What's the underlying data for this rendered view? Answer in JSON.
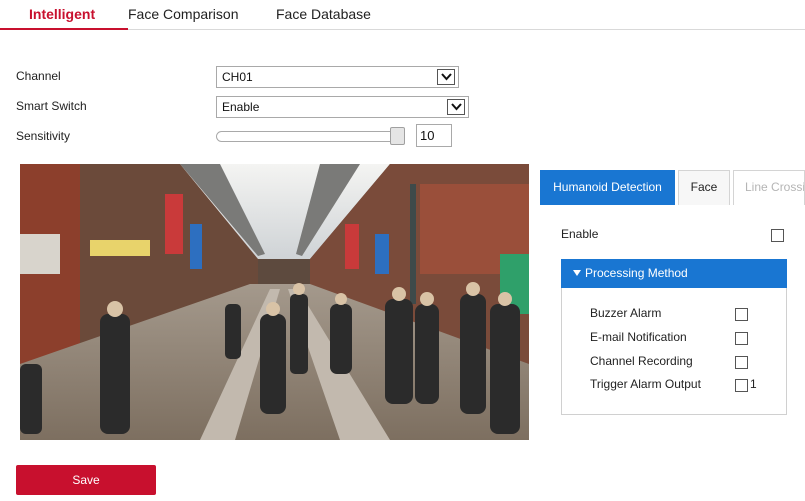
{
  "tabs": [
    {
      "label": "Intelligent",
      "active": true
    },
    {
      "label": "Face Comparison",
      "active": false
    },
    {
      "label": "Face Database",
      "active": false
    }
  ],
  "form": {
    "channel": {
      "label": "Channel",
      "value": "CH01"
    },
    "smart_switch": {
      "label": "Smart Switch",
      "value": "Enable"
    },
    "sensitivity": {
      "label": "Sensitivity",
      "value": "10"
    }
  },
  "detection_tabs": [
    {
      "label": "Humanoid Detection",
      "state": "active"
    },
    {
      "label": "Face",
      "state": "normal"
    },
    {
      "label": "Line Crossi",
      "state": "disabled"
    }
  ],
  "panel": {
    "enable_label": "Enable",
    "processing_method": {
      "title": "Processing Method",
      "items": [
        {
          "label": "Buzzer Alarm"
        },
        {
          "label": "E-mail Notification"
        },
        {
          "label": "Channel Recording"
        },
        {
          "label": "Trigger Alarm Output",
          "suffix": "1"
        }
      ]
    }
  },
  "save_label": "Save",
  "colors": {
    "accent_red": "#c8102e",
    "accent_blue": "#1976d2"
  }
}
